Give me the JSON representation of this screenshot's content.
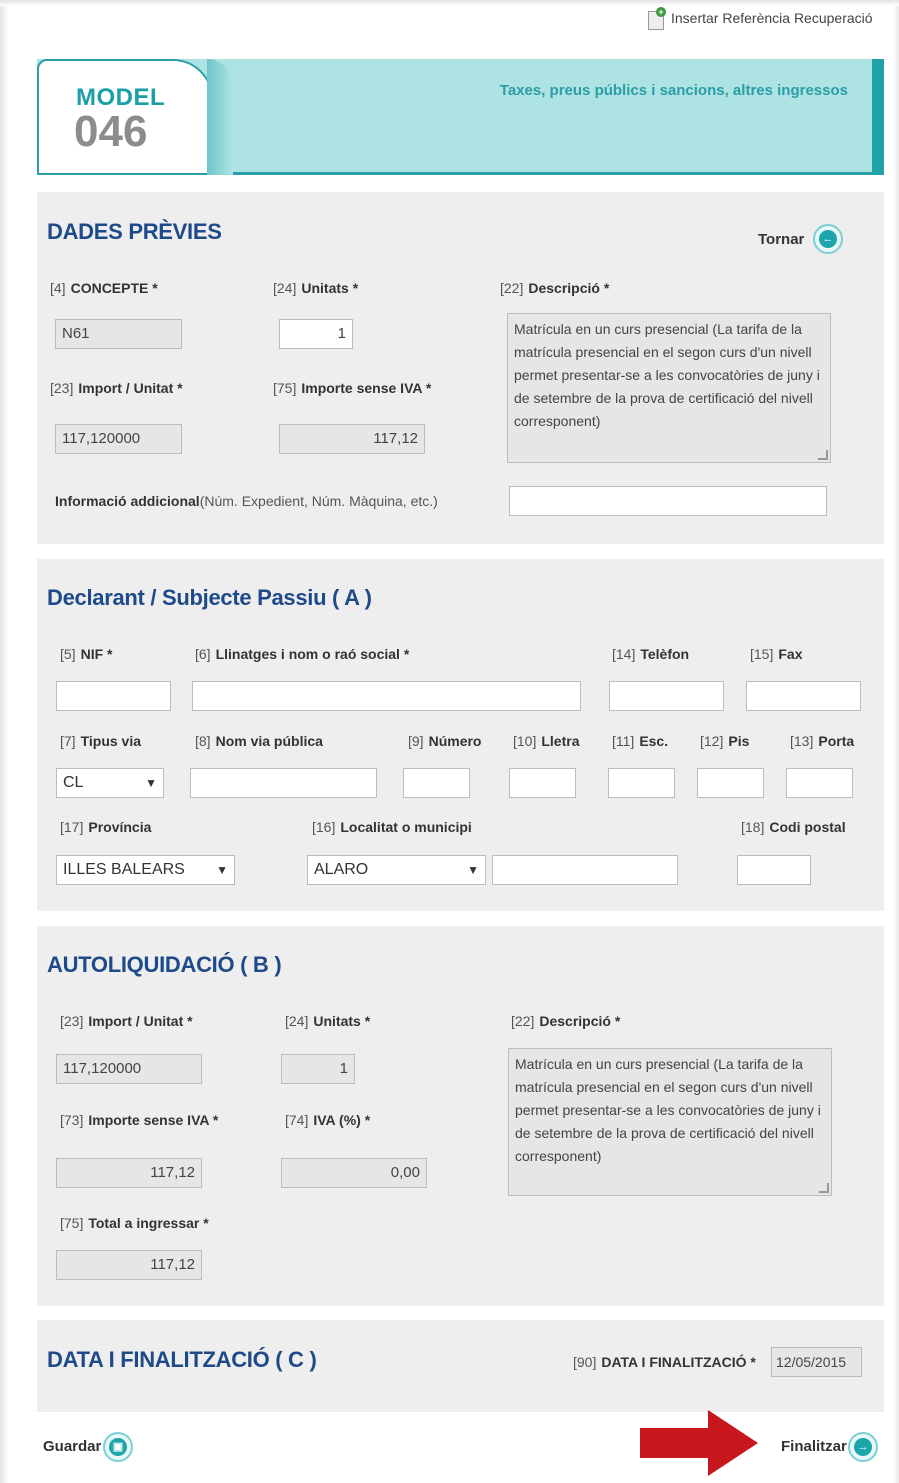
{
  "top_link": {
    "label": "Insertar Referència Recuperació",
    "icon": "document-pin-icon"
  },
  "header": {
    "model_label": "MODEL",
    "model_number": "046",
    "title": "Taxes, preus públics i sancions, altres ingressos"
  },
  "dades_previes": {
    "title": "DADES PRÈVIES",
    "back_label": "Tornar",
    "concepte": {
      "num": "[4]",
      "label": "CONCEPTE *",
      "value": "N61"
    },
    "unitats": {
      "num": "[24]",
      "label": "Unitats *",
      "value": "1"
    },
    "descripcio": {
      "num": "[22]",
      "label": "Descripció *",
      "value": "Matrícula en un curs presencial (La tarifa de la matrícula presencial en el segon curs d'un nivell permet presentar-se a les convocatòries de juny i de setembre de la prova de certificació del nivell corresponent)"
    },
    "import_unitat": {
      "num": "[23]",
      "label": "Import / Unitat *",
      "value": "117,120000"
    },
    "importe_sense_iva": {
      "num": "[75]",
      "label": "Importe sense IVA *",
      "value": "117,12"
    },
    "info_addicional": {
      "label_bold": "Informació addicional",
      "label_rest": "(Núm. Expedient, Núm. Màquina, etc.)",
      "value": ""
    }
  },
  "declarant": {
    "title": "Declarant / Subjecte Passiu ( A )",
    "nif": {
      "num": "[5]",
      "label": "NIF *"
    },
    "llinatges": {
      "num": "[6]",
      "label": "Llinatges i nom o raó social *"
    },
    "telefon": {
      "num": "[14]",
      "label": "Telèfon"
    },
    "fax": {
      "num": "[15]",
      "label": "Fax"
    },
    "tipus_via": {
      "num": "[7]",
      "label": "Tipus via",
      "value": "CL"
    },
    "nom_via": {
      "num": "[8]",
      "label": "Nom via pública"
    },
    "numero": {
      "num": "[9]",
      "label": "Número"
    },
    "lletra": {
      "num": "[10]",
      "label": "Lletra"
    },
    "esc": {
      "num": "[11]",
      "label": "Esc."
    },
    "pis": {
      "num": "[12]",
      "label": "Pis"
    },
    "porta": {
      "num": "[13]",
      "label": "Porta"
    },
    "provincia": {
      "num": "[17]",
      "label": "Província",
      "value": "ILLES BALEARS"
    },
    "localitat": {
      "num": "[16]",
      "label": "Localitat o municipi",
      "value": "ALARO"
    },
    "codi_postal": {
      "num": "[18]",
      "label": "Codi postal"
    }
  },
  "autoliquidacio": {
    "title": "AUTOLIQUIDACIÓ ( B )",
    "import_unitat": {
      "num": "[23]",
      "label": "Import / Unitat *",
      "value": "117,120000"
    },
    "unitats": {
      "num": "[24]",
      "label": "Unitats *",
      "value": "1"
    },
    "descripcio": {
      "num": "[22]",
      "label": "Descripció *",
      "value": "Matrícula en un curs presencial (La tarifa de la matrícula presencial en el segon curs d'un nivell permet presentar-se a les convocatòries de juny i de setembre de la prova de certificació del nivell corresponent)"
    },
    "importe_sense_iva": {
      "num": "[73]",
      "label": "Importe sense IVA *",
      "value": "117,12"
    },
    "iva": {
      "num": "[74]",
      "label": "IVA (%) *",
      "value": "0,00"
    },
    "total": {
      "num": "[75]",
      "label": "Total a ingressar *",
      "value": "117,12"
    }
  },
  "finalitzacio": {
    "title": "DATA I FINALITZACIÓ ( C )",
    "data": {
      "num": "[90]",
      "label": "DATA I FINALITZACIÓ *",
      "value": "12/05/2015"
    }
  },
  "footer": {
    "save_label": "Guardar",
    "finish_label": "Finalitzar",
    "arrow_color": "#c8161d"
  },
  "colors": {
    "accent": "#1fa3a8",
    "section_title": "#1f4a8a",
    "panel_bg": "#eeeeee"
  }
}
